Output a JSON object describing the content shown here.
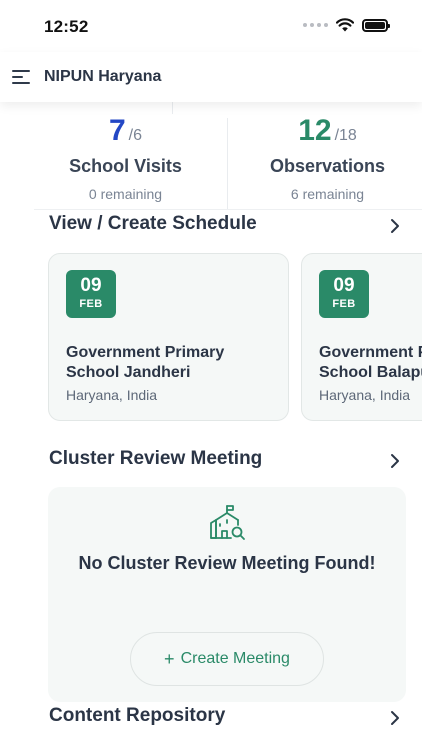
{
  "status_bar": {
    "time": "12:52"
  },
  "header": {
    "title": "NIPUN Haryana"
  },
  "stats": [
    {
      "value": "7",
      "total": "/6",
      "label": "School Visits",
      "sub": "0 remaining",
      "color": "#2347c5"
    },
    {
      "value": "12",
      "total": "/18",
      "label": "Observations",
      "sub": "6 remaining",
      "color": "#2a8a68"
    }
  ],
  "schedule": {
    "title": "View / Create Schedule",
    "cards": [
      {
        "day": "09",
        "month": "FEB",
        "school": "Government Primary\nSchool Jandheri",
        "location": "Haryana, India"
      },
      {
        "day": "09",
        "month": "FEB",
        "school": "Government Primary\nSchool Balapur",
        "location": "Haryana, India"
      }
    ]
  },
  "cluster": {
    "title": "Cluster Review Meeting",
    "empty_message": "No Cluster Review Meeting Found!",
    "button_label": "Create Meeting"
  },
  "content": {
    "title": "Content Repository"
  },
  "colors": {
    "accent": "#2a8a68",
    "blue": "#2347c5",
    "card_bg": "#f5f8f7"
  }
}
